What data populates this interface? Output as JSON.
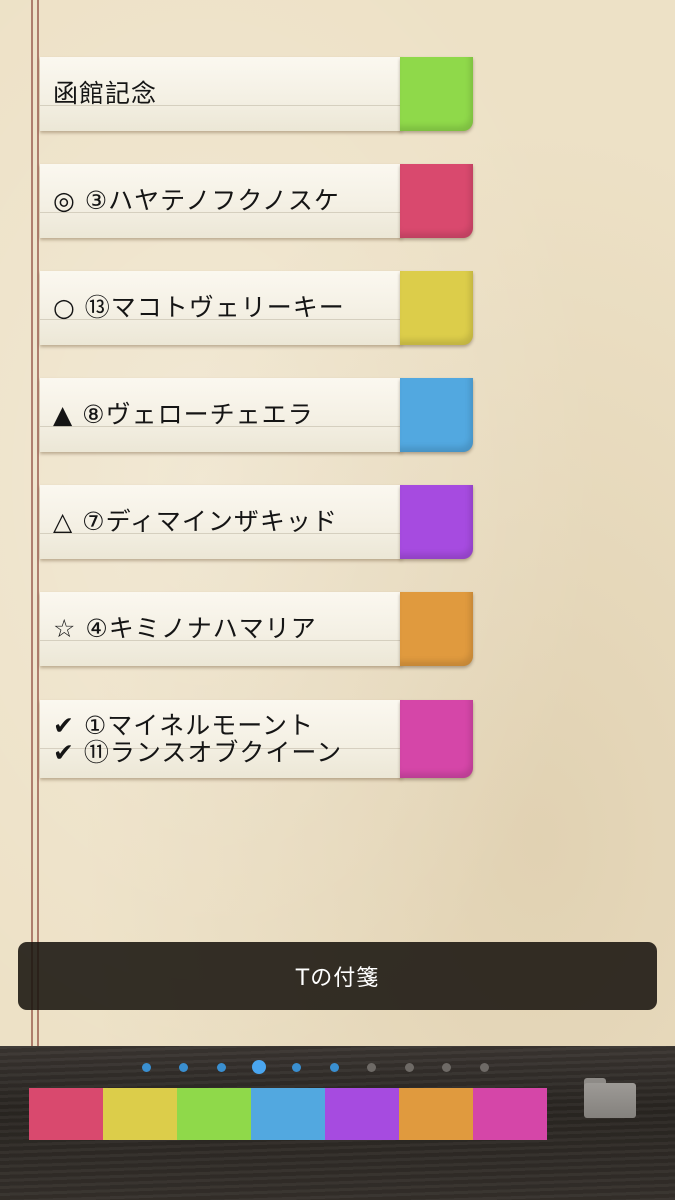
{
  "notes": [
    {
      "label": "函館記念",
      "color": "#8fd94a"
    },
    {
      "label": "◎ ③ハヤテノフクノスケ",
      "color": "#d9496e"
    },
    {
      "label": "○ ⑬マコトヴェリーキー",
      "color": "#dccd4a"
    },
    {
      "label": "▲ ⑧ヴェローチェエラ",
      "color": "#52a8e0"
    },
    {
      "label": "△ ⑦ディマインザキッド",
      "color": "#a64be0"
    },
    {
      "label": "☆ ④キミノナハマリア",
      "color": "#e09a3e"
    },
    {
      "label": "✔ ①マイネルモーント\n✔ ⑪ランスオブクイーン",
      "color": "#d546a8"
    }
  ],
  "toast": {
    "text": "Tの付箋"
  },
  "page_dots": {
    "count": 10,
    "active_index": 3
  },
  "swatches": [
    "#d9496e",
    "#dccd4a",
    "#8fd94a",
    "#52a8e0",
    "#a64be0",
    "#e09a3e",
    "#d546a8"
  ],
  "folder_icon": "folder-icon",
  "colors": {
    "dot_blue": "#3a8fd0",
    "dot_gray": "#6e6a66",
    "dot_active": "#4aa6f0"
  }
}
